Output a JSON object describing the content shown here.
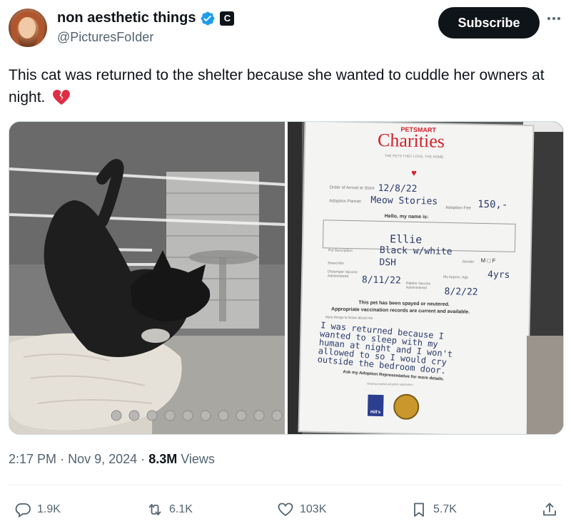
{
  "author": {
    "display_name": "non aesthetic things",
    "handle": "@PicturesFoIder",
    "badge_letter": "C"
  },
  "header": {
    "subscribe_label": "Subscribe",
    "more_icon": "more-horizontal-icon"
  },
  "tweet": {
    "text": "This cat was returned to the shelter because she wanted to cuddle her owners at night.",
    "emoji": "broken-heart"
  },
  "card": {
    "logo_small": "PETSMART",
    "logo_title": "Charities",
    "tagline": "THE PETS THEY LOVE, THE HOME",
    "order_arrival_label": "Order of Arrival at Store",
    "order_arrival_value": "12/8/22",
    "adoption_partner_label": "Adoption Partner",
    "adoption_partner_value": "Meow Stories",
    "adoption_fee_label": "Adoption Fee",
    "adoption_fee_value": "150,-",
    "hello_label": "Hello, my name is:",
    "pet_name": "Ellie",
    "pet_description_label": "Pet Description",
    "pet_description_value": "Black w/white",
    "breed_label": "Breed Mix",
    "breed_value": "DSH",
    "gender_label": "Gender",
    "gender_options": "M □ F",
    "approx_age_label": "My Approx. Age",
    "approx_age_value": "4yrs",
    "distemper_label": "Distemper Vaccine Administered",
    "distemper_value": "8/11/22",
    "rabies_label": "Rabies Vaccine Administered",
    "rabies_value": "8/2/22",
    "spay_line1": "This pet has been spayed or neutered.",
    "spay_line2": "Appropriate vaccination records are current and available.",
    "know_label": "Here things to know about me",
    "note_lines": [
      "I was returned because I",
      "wanted to sleep with my",
      "human at night and I won't",
      "allowed to so I would cry",
      "outside the bedroom door."
    ],
    "ask_line": "Ask my Adoption Representative for more details.",
    "small_print": "Viewing original adoption application.",
    "sponsor_logo_left": "Hill's",
    "sponsor_logo_right": "PetSmart"
  },
  "meta": {
    "time": "2:17 PM",
    "dot": "·",
    "date": "Nov 9, 2024",
    "views_count": "8.3M",
    "views_label": "Views"
  },
  "actions": {
    "replies": "1.9K",
    "reposts": "6.1K",
    "likes": "103K",
    "bookmarks": "5.7K"
  },
  "colors": {
    "text": "#0f1419",
    "secondary": "#536471",
    "verified_blue": "#1d9bf0",
    "brand_red": "#d4202a",
    "subscribe_bg": "#0f1419"
  }
}
